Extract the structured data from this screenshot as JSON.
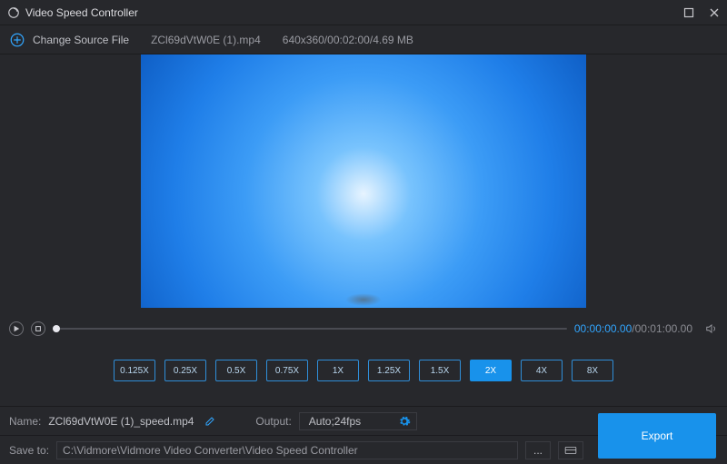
{
  "titlebar": {
    "app_name": "Video Speed Controller"
  },
  "filebar": {
    "change_source_label": "Change Source File",
    "filename": "ZCl69dVtW0E (1).mp4",
    "fileinfo": "640x360/00:02:00/4.69 MB"
  },
  "transport": {
    "current_time": "00:00:00.00",
    "separator": "/",
    "total_time": "00:01:00.00"
  },
  "speeds": {
    "options": [
      "0.125X",
      "0.25X",
      "0.5X",
      "0.75X",
      "1X",
      "1.25X",
      "1.5X",
      "2X",
      "4X",
      "8X"
    ],
    "active_index": 7
  },
  "meta": {
    "name_label": "Name:",
    "name_value": "ZCl69dVtW0E (1)_speed.mp4",
    "output_label": "Output:",
    "output_value": "Auto;24fps"
  },
  "saveto": {
    "label": "Save to:",
    "path": "C:\\Vidmore\\Vidmore Video Converter\\Video Speed Controller",
    "more": "..."
  },
  "export": {
    "label": "Export"
  }
}
